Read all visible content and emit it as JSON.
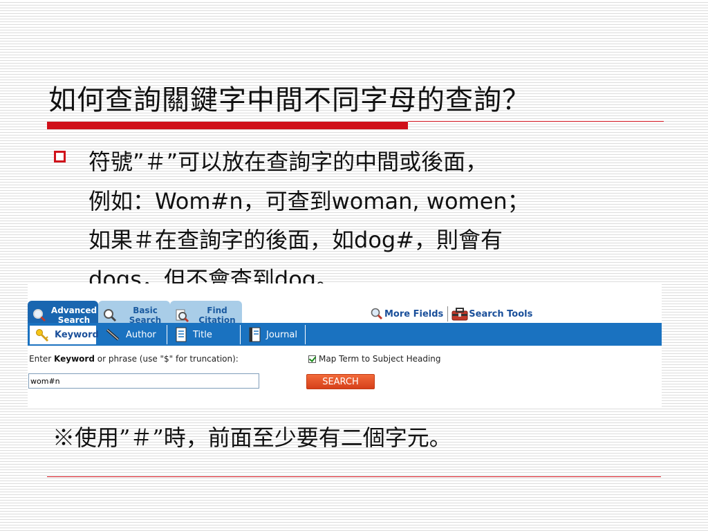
{
  "slide": {
    "title": "如何查詢關鍵字中間不同字母的查詢？",
    "bullet_lines": [
      "符號”＃”可以放在查詢字的中間或後面，",
      "例如：Wom#n，可查到woman, women；",
      "如果＃在查詢字的後面，如dog#，則會有",
      "dogs，但不會查到dog。"
    ],
    "note": "※使用”＃”時，前面至少要有二個字元。"
  },
  "screenshot": {
    "tabs": [
      {
        "label_line1": "Advanced",
        "label_line2": "Search",
        "icon": "magnifier-icon",
        "active": true
      },
      {
        "label_line1": "Basic",
        "label_line2": "Search",
        "icon": "magnifier-icon",
        "active": false
      },
      {
        "label_line1": "Find",
        "label_line2": "Citation",
        "icon": "magnifier-document-icon",
        "active": false
      }
    ],
    "top_links": [
      {
        "label": "More Fields",
        "icon": "magnifier-icon"
      },
      {
        "label": "Search Tools",
        "icon": "toolbox-icon"
      }
    ],
    "subtabs": [
      {
        "label": "Keyword",
        "icon": "key-icon",
        "active": true
      },
      {
        "label": "Author",
        "icon": "pen-icon",
        "active": false
      },
      {
        "label": "Title",
        "icon": "document-icon",
        "active": false
      },
      {
        "label": "Journal",
        "icon": "journal-icon",
        "active": false
      }
    ],
    "search_label_prefix": "Enter ",
    "search_label_bold": "Keyword",
    "search_label_suffix": " or phrase (use \"$\" for truncation):",
    "map_term_label": "Map Term to Subject Heading",
    "map_term_checked": true,
    "search_value": "wom#n",
    "search_button": "SEARCH"
  },
  "colors": {
    "accent_red": "#d0101a",
    "tab_blue": "#1a72c0",
    "search_orange": "#e8542a"
  }
}
